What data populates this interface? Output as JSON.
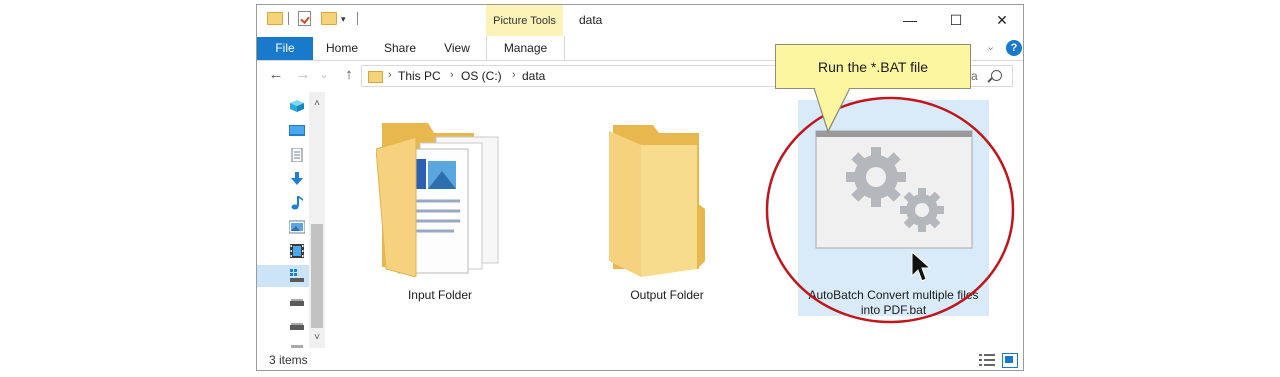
{
  "window": {
    "title": "data",
    "contextual_tab_header": "Picture Tools",
    "controls": {
      "minimize": "—",
      "maximize": "☐",
      "close": "✕"
    }
  },
  "quick_access_toolbar": {
    "dropdown_glyph": "▾"
  },
  "ribbon": {
    "tabs": [
      {
        "label": "File",
        "active": true,
        "color": "#1979ca"
      },
      {
        "label": "Home"
      },
      {
        "label": "Share"
      },
      {
        "label": "View"
      },
      {
        "label": "Manage"
      }
    ],
    "collapse_glyph": "⌄",
    "help_glyph": "?"
  },
  "navigation": {
    "back_glyph": "←",
    "forward_glyph": "→",
    "recent_glyph": "⌄",
    "up_glyph": "↑",
    "breadcrumbs": [
      "This PC",
      "OS (C:)",
      "data"
    ],
    "crumb_separator": "›",
    "search_visible_text": "ata"
  },
  "nav_pane": {
    "icons": [
      "3d-objects-icon",
      "desktop-icon",
      "documents-icon",
      "downloads-icon",
      "music-icon",
      "pictures-icon",
      "videos-icon",
      "os-drive-icon",
      "drive-icon",
      "drive-icon",
      "drive-icon"
    ],
    "scroll_up_glyph": "˄",
    "scroll_down_glyph": "˅"
  },
  "items": [
    {
      "label": "Input Folder",
      "type": "folder-with-documents"
    },
    {
      "label": "Output Folder",
      "type": "empty-folder"
    },
    {
      "label": "AutoBatch Convert multiple files into PDF.bat",
      "label_lines": [
        "AutoBatch Convert multiple files",
        "into PDF.bat"
      ],
      "type": "batch-file",
      "selected": true
    }
  ],
  "status_bar": {
    "item_count": "3 items"
  },
  "annotation": {
    "callout_text": "Run the *.BAT file",
    "circle_color": "#c0151b",
    "callout_color": "#fdf6a0"
  }
}
